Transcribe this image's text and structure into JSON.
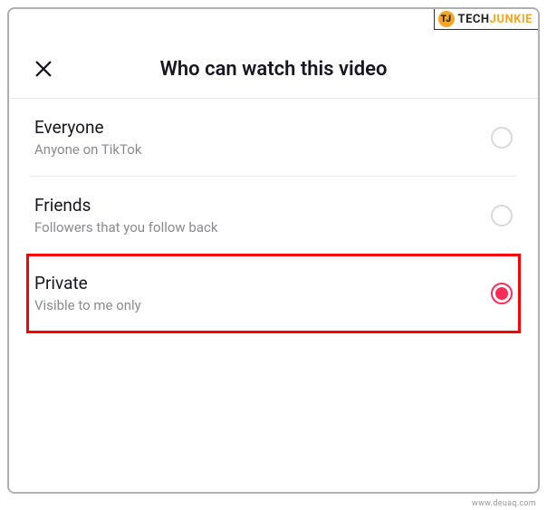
{
  "badge": {
    "brand_prefix": "TECH",
    "brand_suffix": "JUNKIE"
  },
  "header": {
    "title": "Who can watch this video"
  },
  "options": [
    {
      "label": "Everyone",
      "description": "Anyone on TikTok",
      "selected": false,
      "highlighted": false
    },
    {
      "label": "Friends",
      "description": "Followers that you follow back",
      "selected": false,
      "highlighted": false
    },
    {
      "label": "Private",
      "description": "Visible to me only",
      "selected": true,
      "highlighted": true
    }
  ],
  "watermark": "www.deuaq.com"
}
